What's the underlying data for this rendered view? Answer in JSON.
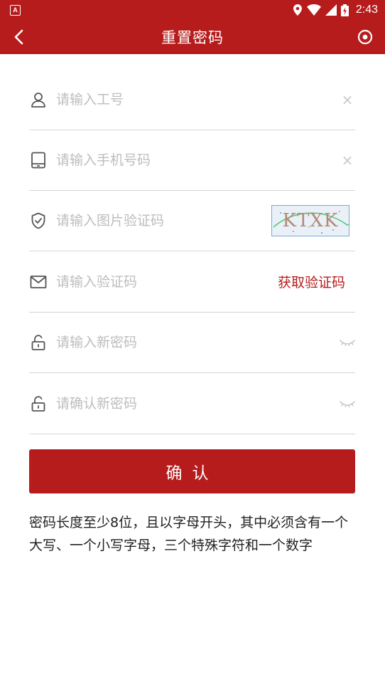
{
  "status_bar": {
    "time": "2:43",
    "app_badge": "A"
  },
  "app_bar": {
    "title": "重置密码"
  },
  "form": {
    "employee_id": {
      "placeholder": "请输入工号",
      "value": ""
    },
    "phone": {
      "placeholder": "请输入手机号码",
      "value": ""
    },
    "image_captcha": {
      "placeholder": "请输入图片验证码",
      "value": "",
      "captcha_text": "KTXK"
    },
    "sms_code": {
      "placeholder": "请输入验证码",
      "value": "",
      "get_code_label": "获取验证码"
    },
    "new_password": {
      "placeholder": "请输入新密码",
      "value": ""
    },
    "confirm_password": {
      "placeholder": "请确认新密码",
      "value": ""
    },
    "clear_glyph": "×"
  },
  "confirm_button": {
    "label": "确认"
  },
  "hint_text": "密码长度至少8位，且以字母开头，其中必须含有一个大写、一个小写字母，三个特殊字符和一个数字",
  "colors": {
    "primary": "#b71c1c",
    "placeholder": "#bdbdbd",
    "divider": "#d6d6d6"
  }
}
